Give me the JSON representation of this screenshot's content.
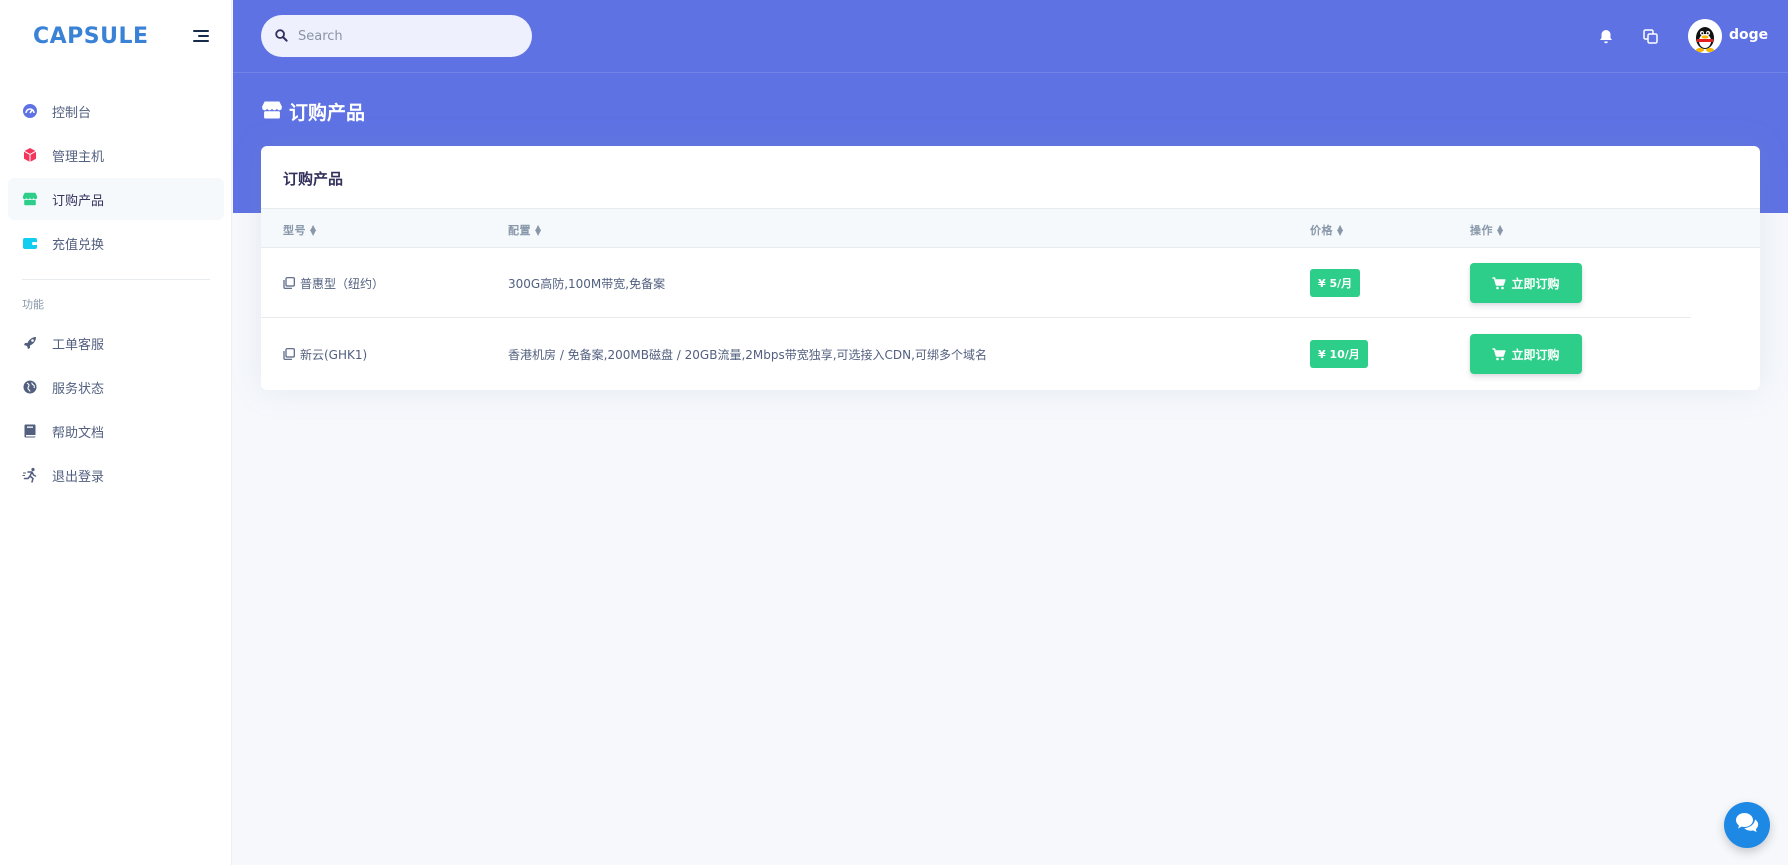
{
  "brand": {
    "name": "CAPSULE"
  },
  "search": {
    "placeholder": "Search"
  },
  "user": {
    "name": "doge"
  },
  "sidebar": {
    "items": [
      {
        "label": "控制台",
        "icon": "dashboard-icon"
      },
      {
        "label": "管理主机",
        "icon": "cube-icon"
      },
      {
        "label": "订购产品",
        "icon": "store-icon",
        "active": true
      },
      {
        "label": "充值兑换",
        "icon": "wallet-icon"
      }
    ],
    "section_title": "功能",
    "function_items": [
      {
        "label": "工单客服",
        "icon": "rocket-icon"
      },
      {
        "label": "服务状态",
        "icon": "globe-icon"
      },
      {
        "label": "帮助文档",
        "icon": "book-icon"
      },
      {
        "label": "退出登录",
        "icon": "running-icon"
      }
    ]
  },
  "page": {
    "title": "订购产品"
  },
  "card": {
    "title": "订购产品",
    "columns": [
      "型号",
      "配置",
      "价格",
      "操作"
    ],
    "rows": [
      {
        "model": "普惠型（纽约）",
        "config": "300G高防,100M带宽,免备案",
        "price": "¥ 5/月",
        "action": "立即订购"
      },
      {
        "model": "新云(GHK1)",
        "config": "香港机房 / 免备案,200MB磁盘 / 20GB流量,2Mbps带宽独享,可选接入CDN,可绑多个域名",
        "price": "¥ 10/月",
        "action": "立即订购"
      }
    ]
  },
  "colors": {
    "primary": "#5e72e4",
    "success": "#2dce89",
    "brand": "#3a82d6",
    "chat": "#1e88e5"
  }
}
